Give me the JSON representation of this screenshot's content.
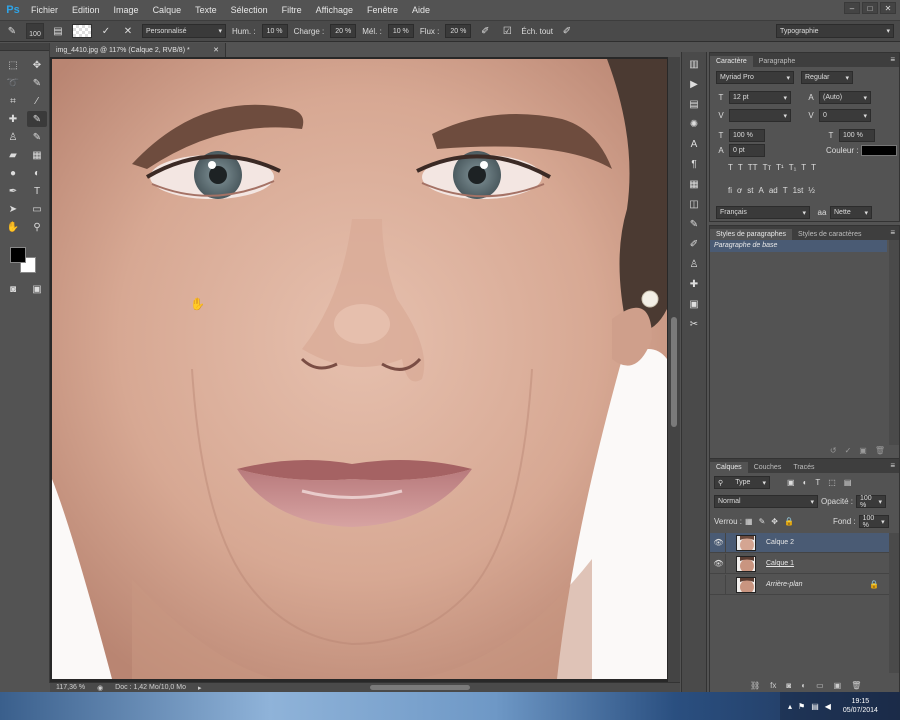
{
  "app": {
    "logo": "Ps"
  },
  "menu": [
    "Fichier",
    "Edition",
    "Image",
    "Calque",
    "Texte",
    "Sélection",
    "Filtre",
    "Affichage",
    "Fenêtre",
    "Aide"
  ],
  "window_controls": [
    "–",
    "□",
    "✕"
  ],
  "options": {
    "brush_size": "100",
    "mode_select": "Personnalisé",
    "hum_label": "Hum. :",
    "hum_value": "10 %",
    "charge_label": "Charge :",
    "charge_value": "20 %",
    "mel_label": "Mél. :",
    "mel_value": "10 %",
    "flux_label": "Flux :",
    "flux_value": "20 %",
    "ech_label": "Éch. tout",
    "workspace": "Typographie"
  },
  "document": {
    "tab_title": "img_4410.jpg @ 117% (Calque 2, RVB/8) *",
    "zoom": "117,36 %",
    "doc_info": "Doc : 1,42 Mo/10,0 Mo"
  },
  "character": {
    "tabs": [
      "Caractère",
      "Paragraphe"
    ],
    "font_family": "Myriad Pro",
    "font_style": "Regular",
    "size": "12 pt",
    "leading": "(Auto)",
    "tracking": "0",
    "vscale": "100 %",
    "hscale": "100 %",
    "baseline": "0 pt",
    "color_label": "Couleur :",
    "styles": [
      "T",
      "T",
      "TT",
      "Tт",
      "T¹",
      "T₁",
      "T",
      "T"
    ],
    "opentype": [
      "fi",
      "ơ",
      "st",
      "A",
      "ad",
      "T",
      "1st",
      "½"
    ],
    "language": "Français",
    "aa_label": "aa",
    "antialias": "Nette"
  },
  "paragraph_styles": {
    "tabs": [
      "Styles de paragraphes",
      "Styles de caractères"
    ],
    "items": [
      "Paragraphe de base"
    ]
  },
  "layers": {
    "tabs": [
      "Calques",
      "Couches",
      "Tracés"
    ],
    "filter": "Type",
    "blend_mode": "Normal",
    "opacity_label": "Opacité :",
    "opacity": "100 %",
    "lock_label": "Verrou :",
    "fill_label": "Fond :",
    "fill": "100 %",
    "rows": [
      {
        "name": "Calque 2",
        "selected": true
      },
      {
        "name": "Calque 1",
        "selected": false
      },
      {
        "name": "Arrière-plan",
        "selected": false
      }
    ]
  },
  "taskbar": {
    "time": "19:15",
    "date": "05/07/2014"
  }
}
